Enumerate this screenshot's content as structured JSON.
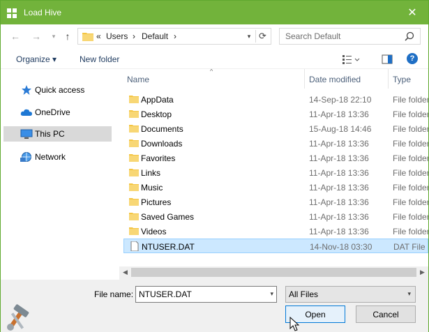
{
  "window": {
    "title": "Load Hive",
    "close_glyph": "✕"
  },
  "nav": {
    "back": "←",
    "forward": "→",
    "up": "↑",
    "breadcrumb": [
      "«",
      "Users",
      "›",
      "Default",
      "›"
    ],
    "search_placeholder": "Search Default"
  },
  "toolbar": {
    "organize": "Organize ▾",
    "new_folder": "New folder",
    "help": "?"
  },
  "sidebar": {
    "items": [
      {
        "label": "Quick access",
        "icon": "star-icon"
      },
      {
        "label": "OneDrive",
        "icon": "cloud-icon"
      },
      {
        "label": "This PC",
        "icon": "monitor-icon",
        "selected": true
      },
      {
        "label": "Network",
        "icon": "network-icon"
      }
    ]
  },
  "columns": {
    "name": "Name",
    "date": "Date modified",
    "type": "Type"
  },
  "files": [
    {
      "name": "AppData",
      "date": "14-Sep-18 22:10",
      "type": "File folder",
      "kind": "folder"
    },
    {
      "name": "Desktop",
      "date": "11-Apr-18 13:36",
      "type": "File folder",
      "kind": "folder"
    },
    {
      "name": "Documents",
      "date": "15-Aug-18 14:46",
      "type": "File folder",
      "kind": "folder"
    },
    {
      "name": "Downloads",
      "date": "11-Apr-18 13:36",
      "type": "File folder",
      "kind": "folder"
    },
    {
      "name": "Favorites",
      "date": "11-Apr-18 13:36",
      "type": "File folder",
      "kind": "folder"
    },
    {
      "name": "Links",
      "date": "11-Apr-18 13:36",
      "type": "File folder",
      "kind": "folder"
    },
    {
      "name": "Music",
      "date": "11-Apr-18 13:36",
      "type": "File folder",
      "kind": "folder"
    },
    {
      "name": "Pictures",
      "date": "11-Apr-18 13:36",
      "type": "File folder",
      "kind": "folder"
    },
    {
      "name": "Saved Games",
      "date": "11-Apr-18 13:36",
      "type": "File folder",
      "kind": "folder"
    },
    {
      "name": "Videos",
      "date": "11-Apr-18 13:36",
      "type": "File folder",
      "kind": "folder"
    },
    {
      "name": "NTUSER.DAT",
      "date": "14-Nov-18 03:30",
      "type": "DAT File",
      "kind": "file",
      "selected": true
    }
  ],
  "bottom": {
    "file_name_label": "File name:",
    "file_name_value": "NTUSER.DAT",
    "filter_value": "All Files",
    "open_label": "Open",
    "cancel_label": "Cancel"
  },
  "colors": {
    "titlebar": "#72b33b",
    "selection": "#cce8ff",
    "folder": "#f4c542"
  }
}
